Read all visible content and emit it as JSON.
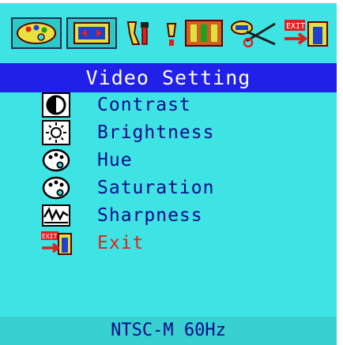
{
  "osd": {
    "title": "Video Setting",
    "toolbar": [
      {
        "icon": "color-palette-icon",
        "selected": true
      },
      {
        "icon": "display-adjust-icon",
        "selected": true
      },
      {
        "icon": "tools-icon",
        "selected": false
      },
      {
        "icon": "osd-settings-icon",
        "selected": false
      },
      {
        "icon": "scissors-icon",
        "selected": false
      },
      {
        "icon": "exit-icon",
        "selected": false
      }
    ],
    "menu": [
      {
        "label": "Contrast",
        "icon": "contrast-icon"
      },
      {
        "label": "Brightness",
        "icon": "brightness-icon"
      },
      {
        "label": "Hue",
        "icon": "hue-icon"
      },
      {
        "label": "Saturation",
        "icon": "saturation-icon"
      },
      {
        "label": "Sharpness",
        "icon": "sharpness-icon"
      },
      {
        "label": "Exit",
        "icon": "exit-icon"
      }
    ],
    "status": "NTSC-M 60Hz"
  },
  "colors": {
    "background": "#3ee3e3",
    "title_bar": "#2020e8",
    "title_text": "#ffffff",
    "label_text": "#0a0a8a",
    "exit_text": "#e8201a"
  }
}
